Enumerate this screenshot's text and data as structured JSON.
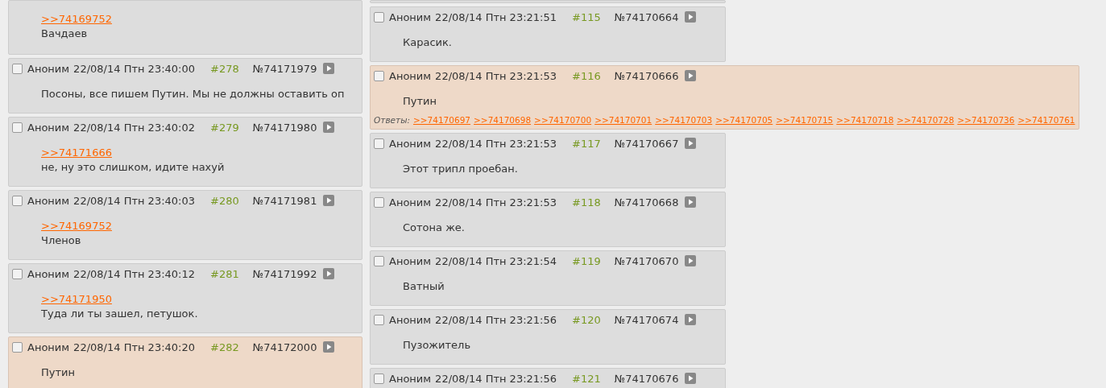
{
  "columns": [
    {
      "posts": [
        {
          "kind": "partial",
          "highlighted": false,
          "reply_to": ">>74169752",
          "text": "Вачдаев"
        },
        {
          "kind": "post",
          "highlighted": false,
          "checked": false,
          "name": "Аноним",
          "date": "22/08/14 Птн 23:40:00",
          "index": "#278",
          "number": "№74171979",
          "text": "Посоны, все пишем Путин. Мы не должны оставить оп"
        },
        {
          "kind": "post",
          "highlighted": false,
          "checked": false,
          "name": "Аноним",
          "date": "22/08/14 Птн 23:40:02",
          "index": "#279",
          "number": "№74171980",
          "reply_to": ">>74171666",
          "text": "не, ну это слишком, идите нахуй"
        },
        {
          "kind": "post",
          "highlighted": false,
          "checked": false,
          "name": "Аноним",
          "date": "22/08/14 Птн 23:40:03",
          "index": "#280",
          "number": "№74171981",
          "reply_to": ">>74169752",
          "text": "Членов"
        },
        {
          "kind": "post",
          "highlighted": false,
          "checked": false,
          "name": "Аноним",
          "date": "22/08/14 Птн 23:40:12",
          "index": "#281",
          "number": "№74171992",
          "reply_to": ">>74171950",
          "text": "Туда ли ты зашел, петушок."
        },
        {
          "kind": "post",
          "highlighted": true,
          "checked": false,
          "name": "Аноним",
          "date": "22/08/14 Птн 23:40:20",
          "index": "#282",
          "number": "№74172000",
          "text": "Путин"
        }
      ]
    },
    {
      "posts": [
        {
          "kind": "partial",
          "highlighted": false
        },
        {
          "kind": "post",
          "highlighted": false,
          "checked": false,
          "name": "Аноним",
          "date": "22/08/14 Птн 23:21:51",
          "index": "#115",
          "number": "№74170664",
          "text": "Карасик."
        },
        {
          "kind": "post",
          "highlighted": true,
          "checked": false,
          "name": "Аноним",
          "date": "22/08/14 Птн 23:21:53",
          "index": "#116",
          "number": "№74170666",
          "text": "Путин",
          "replies_label": "Ответы:",
          "replies": [
            ">>74170697",
            ">>74170698",
            ">>74170700",
            ">>74170701",
            ">>74170703",
            ">>74170705",
            ">>74170715",
            ">>74170718",
            ">>74170728",
            ">>74170736",
            ">>74170761"
          ]
        },
        {
          "kind": "post",
          "highlighted": false,
          "checked": false,
          "name": "Аноним",
          "date": "22/08/14 Птн 23:21:53",
          "index": "#117",
          "number": "№74170667",
          "text": "Этот трипл проебан."
        },
        {
          "kind": "post",
          "highlighted": false,
          "checked": false,
          "name": "Аноним",
          "date": "22/08/14 Птн 23:21:53",
          "index": "#118",
          "number": "№74170668",
          "text": "Сотона же."
        },
        {
          "kind": "post",
          "highlighted": false,
          "checked": false,
          "name": "Аноним",
          "date": "22/08/14 Птн 23:21:54",
          "index": "#119",
          "number": "№74170670",
          "text": "Ватный"
        },
        {
          "kind": "post",
          "highlighted": false,
          "checked": false,
          "name": "Аноним",
          "date": "22/08/14 Птн 23:21:56",
          "index": "#120",
          "number": "№74170674",
          "text": "Пузожитель"
        },
        {
          "kind": "post",
          "highlighted": false,
          "checked": false,
          "name": "Аноним",
          "date": "22/08/14 Птн 23:21:56",
          "index": "#121",
          "number": "№74170676"
        }
      ]
    }
  ]
}
